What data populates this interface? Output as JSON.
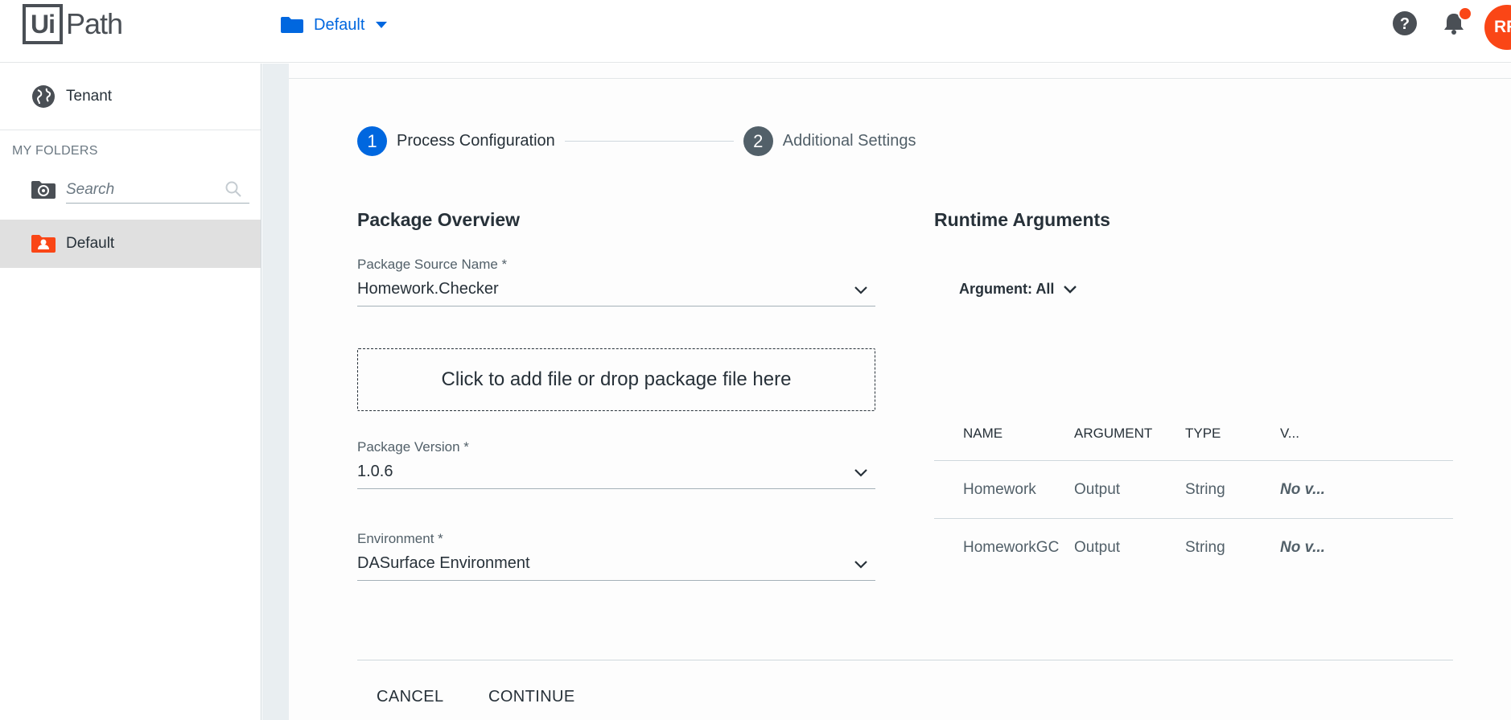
{
  "header": {
    "logo_left": "Ui",
    "logo_right": "Path",
    "folder": "Default",
    "avatar_initials": "RF",
    "icons": {
      "folder": "folder-icon",
      "help": "help-circle-icon",
      "notifications": "bell-icon"
    },
    "colors": {
      "accent": "#0067df",
      "brand_orange": "#fa4616"
    }
  },
  "sidebar": {
    "tenant_label": "Tenant",
    "section_label": "MY FOLDERS",
    "search_placeholder": "Search",
    "folder_label": "Default"
  },
  "stepper": {
    "steps": [
      {
        "number": "1",
        "label": "Process Configuration",
        "active": true
      },
      {
        "number": "2",
        "label": "Additional Settings",
        "active": false
      }
    ]
  },
  "package_overview": {
    "title": "Package Overview",
    "source_name_label": "Package Source Name *",
    "source_name_value": "Homework.Checker",
    "dropzone_text": "Click to add file or drop package file here",
    "version_label": "Package Version *",
    "version_value": "1.0.6",
    "environment_label": "Environment *",
    "environment_value": "DASurface Environment"
  },
  "runtime_arguments": {
    "title": "Runtime Arguments",
    "filter_label": "Argument: All",
    "columns": [
      "NAME",
      "ARGUMENT",
      "TYPE",
      "V..."
    ],
    "rows": [
      {
        "name": "Homework",
        "argument": "Output",
        "type": "String",
        "value": "No v..."
      },
      {
        "name": "HomeworkGC",
        "argument": "Output",
        "type": "String",
        "value": "No v..."
      }
    ]
  },
  "footer": {
    "cancel_label": "CANCEL",
    "continue_label": "CONTINUE"
  }
}
